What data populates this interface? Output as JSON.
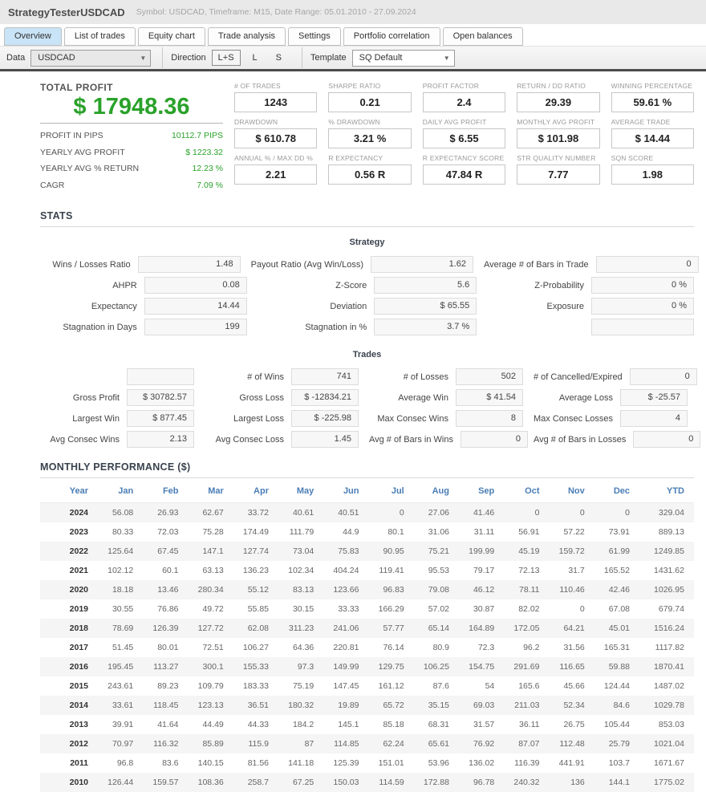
{
  "header": {
    "title": "StrategyTesterUSDCAD",
    "subtitle": "Symbol: USDCAD, Timeframe: M15, Date Range: 05.01.2010 - 27.09.2024"
  },
  "tabs": [
    {
      "label": "Overview",
      "active": true
    },
    {
      "label": "List of trades",
      "active": false
    },
    {
      "label": "Equity chart",
      "active": false
    },
    {
      "label": "Trade analysis",
      "active": false
    },
    {
      "label": "Settings",
      "active": false
    },
    {
      "label": "Portfolio correlation",
      "active": false
    },
    {
      "label": "Open balances",
      "active": false
    }
  ],
  "toolbar": {
    "data_label": "Data",
    "data_value": "USDCAD",
    "direction_label": "Direction",
    "direction_options": [
      "L+S",
      "L",
      "S"
    ],
    "direction_selected": "L+S",
    "template_label": "Template",
    "template_value": "SQ Default",
    "dropdown_arrow": "▼"
  },
  "profit_panel": {
    "title": "TOTAL PROFIT",
    "total": "$ 17948.36",
    "rows": [
      {
        "label": "PROFIT IN PIPS",
        "value": "10112.7 PIPS"
      },
      {
        "label": "YEARLY AVG PROFIT",
        "value": "$ 1223.32"
      },
      {
        "label": "YEARLY AVG % RETURN",
        "value": "12.23 %"
      },
      {
        "label": "CAGR",
        "value": "7.09 %"
      }
    ]
  },
  "metrics": [
    {
      "label": "# OF TRADES",
      "value": "1243"
    },
    {
      "label": "SHARPE RATIO",
      "value": "0.21"
    },
    {
      "label": "PROFIT FACTOR",
      "value": "2.4"
    },
    {
      "label": "RETURN / DD RATIO",
      "value": "29.39"
    },
    {
      "label": "WINNING PERCENTAGE",
      "value": "59.61 %"
    },
    {
      "label": "DRAWDOWN",
      "value": "$ 610.78"
    },
    {
      "label": "% DRAWDOWN",
      "value": "3.21 %"
    },
    {
      "label": "DAILY AVG PROFIT",
      "value": "$ 6.55"
    },
    {
      "label": "MONTHLY AVG PROFIT",
      "value": "$ 101.98"
    },
    {
      "label": "AVERAGE TRADE",
      "value": "$ 14.44"
    },
    {
      "label": "ANNUAL % / MAX DD %",
      "value": "2.21"
    },
    {
      "label": "R EXPECTANCY",
      "value": "0.56 R"
    },
    {
      "label": "R EXPECTANCY SCORE",
      "value": "47.84 R"
    },
    {
      "label": "STR QUALITY NUMBER",
      "value": "7.77"
    },
    {
      "label": "SQN SCORE",
      "value": "1.98"
    }
  ],
  "stats": {
    "heading": "STATS",
    "strategy_title": "Strategy",
    "strategy_rows": [
      [
        {
          "label": "Wins / Losses Ratio",
          "value": "1.48"
        },
        {
          "label": "Payout Ratio (Avg Win/Loss)",
          "value": "1.62"
        },
        {
          "label": "Average # of Bars in Trade",
          "value": "0"
        }
      ],
      [
        {
          "label": "AHPR",
          "value": "0.08"
        },
        {
          "label": "Z-Score",
          "value": "5.6"
        },
        {
          "label": "Z-Probability",
          "value": "0 %"
        }
      ],
      [
        {
          "label": "Expectancy",
          "value": "14.44"
        },
        {
          "label": "Deviation",
          "value": "$ 65.55"
        },
        {
          "label": "Exposure",
          "value": "0 %"
        }
      ],
      [
        {
          "label": "Stagnation in Days",
          "value": "199"
        },
        {
          "label": "Stagnation in %",
          "value": "3.7 %"
        },
        {
          "label": "",
          "value": ""
        }
      ]
    ],
    "trades_title": "Trades",
    "trades_rows": [
      [
        {
          "label": "",
          "value": ""
        },
        {
          "label": "# of Wins",
          "value": "741"
        },
        {
          "label": "# of Losses",
          "value": "502"
        },
        {
          "label": "# of Cancelled/Expired",
          "value": "0"
        }
      ],
      [
        {
          "label": "Gross Profit",
          "value": "$ 30782.57"
        },
        {
          "label": "Gross Loss",
          "value": "$ -12834.21"
        },
        {
          "label": "Average Win",
          "value": "$ 41.54"
        },
        {
          "label": "Average Loss",
          "value": "$ -25.57"
        }
      ],
      [
        {
          "label": "Largest Win",
          "value": "$ 877.45"
        },
        {
          "label": "Largest Loss",
          "value": "$ -225.98"
        },
        {
          "label": "Max Consec Wins",
          "value": "8"
        },
        {
          "label": "Max Consec Losses",
          "value": "4"
        }
      ],
      [
        {
          "label": "Avg Consec Wins",
          "value": "2.13"
        },
        {
          "label": "Avg Consec Loss",
          "value": "1.45"
        },
        {
          "label": "Avg # of Bars in Wins",
          "value": "0"
        },
        {
          "label": "Avg # of Bars in Losses",
          "value": "0"
        }
      ]
    ]
  },
  "monthly": {
    "heading": "MONTHLY PERFORMANCE ($)",
    "columns": [
      "Year",
      "Jan",
      "Feb",
      "Mar",
      "Apr",
      "May",
      "Jun",
      "Jul",
      "Aug",
      "Sep",
      "Oct",
      "Nov",
      "Dec",
      "YTD"
    ],
    "rows": [
      {
        "year": "2024",
        "values": [
          "56.08",
          "26.93",
          "62.67",
          "33.72",
          "40.61",
          "40.51",
          "0",
          "27.06",
          "41.46",
          "0",
          "0",
          "0",
          "329.04"
        ]
      },
      {
        "year": "2023",
        "values": [
          "80.33",
          "72.03",
          "75.28",
          "174.49",
          "111.79",
          "44.9",
          "80.1",
          "31.06",
          "31.11",
          "56.91",
          "57.22",
          "73.91",
          "889.13"
        ]
      },
      {
        "year": "2022",
        "values": [
          "125.64",
          "67.45",
          "147.1",
          "127.74",
          "73.04",
          "75.83",
          "90.95",
          "75.21",
          "199.99",
          "45.19",
          "159.72",
          "61.99",
          "1249.85"
        ]
      },
      {
        "year": "2021",
        "values": [
          "102.12",
          "60.1",
          "63.13",
          "136.23",
          "102.34",
          "404.24",
          "119.41",
          "95.53",
          "79.17",
          "72.13",
          "31.7",
          "165.52",
          "1431.62"
        ]
      },
      {
        "year": "2020",
        "values": [
          "18.18",
          "13.46",
          "280.34",
          "55.12",
          "83.13",
          "123.66",
          "96.83",
          "79.08",
          "46.12",
          "78.11",
          "110.46",
          "42.46",
          "1026.95"
        ]
      },
      {
        "year": "2019",
        "values": [
          "30.55",
          "76.86",
          "49.72",
          "55.85",
          "30.15",
          "33.33",
          "166.29",
          "57.02",
          "30.87",
          "82.02",
          "0",
          "67.08",
          "679.74"
        ]
      },
      {
        "year": "2018",
        "values": [
          "78.69",
          "126.39",
          "127.72",
          "62.08",
          "311.23",
          "241.06",
          "57.77",
          "65.14",
          "164.89",
          "172.05",
          "64.21",
          "45.01",
          "1516.24"
        ]
      },
      {
        "year": "2017",
        "values": [
          "51.45",
          "80.01",
          "72.51",
          "106.27",
          "64.36",
          "220.81",
          "76.14",
          "80.9",
          "72.3",
          "96.2",
          "31.56",
          "165.31",
          "1117.82"
        ]
      },
      {
        "year": "2016",
        "values": [
          "195.45",
          "113.27",
          "300.1",
          "155.33",
          "97.3",
          "149.99",
          "129.75",
          "106.25",
          "154.75",
          "291.69",
          "116.65",
          "59.88",
          "1870.41"
        ]
      },
      {
        "year": "2015",
        "values": [
          "243.61",
          "89.23",
          "109.79",
          "183.33",
          "75.19",
          "147.45",
          "161.12",
          "87.6",
          "54",
          "165.6",
          "45.66",
          "124.44",
          "1487.02"
        ]
      },
      {
        "year": "2014",
        "values": [
          "33.61",
          "118.45",
          "123.13",
          "36.51",
          "180.32",
          "19.89",
          "65.72",
          "35.15",
          "69.03",
          "211.03",
          "52.34",
          "84.6",
          "1029.78"
        ]
      },
      {
        "year": "2013",
        "values": [
          "39.91",
          "41.64",
          "44.49",
          "44.33",
          "184.2",
          "145.1",
          "85.18",
          "68.31",
          "31.57",
          "36.11",
          "26.75",
          "105.44",
          "853.03"
        ]
      },
      {
        "year": "2012",
        "values": [
          "70.97",
          "116.32",
          "85.89",
          "115.9",
          "87",
          "114.85",
          "62.24",
          "65.61",
          "76.92",
          "87.07",
          "112.48",
          "25.79",
          "1021.04"
        ]
      },
      {
        "year": "2011",
        "values": [
          "96.8",
          "83.6",
          "140.15",
          "81.56",
          "141.18",
          "125.39",
          "151.01",
          "53.96",
          "136.02",
          "116.39",
          "441.91",
          "103.7",
          "1671.67"
        ]
      },
      {
        "year": "2010",
        "values": [
          "126.44",
          "159.57",
          "108.36",
          "258.7",
          "67.25",
          "150.03",
          "114.59",
          "172.88",
          "96.78",
          "240.32",
          "136",
          "144.1",
          "1775.02"
        ]
      }
    ]
  },
  "colors": {
    "profit_green": "#2aa22a",
    "table_header_blue": "#4a7db6",
    "active_tab_blue": "#c9e4f6",
    "toolbar_divider_dark": "#4b4b4b"
  }
}
